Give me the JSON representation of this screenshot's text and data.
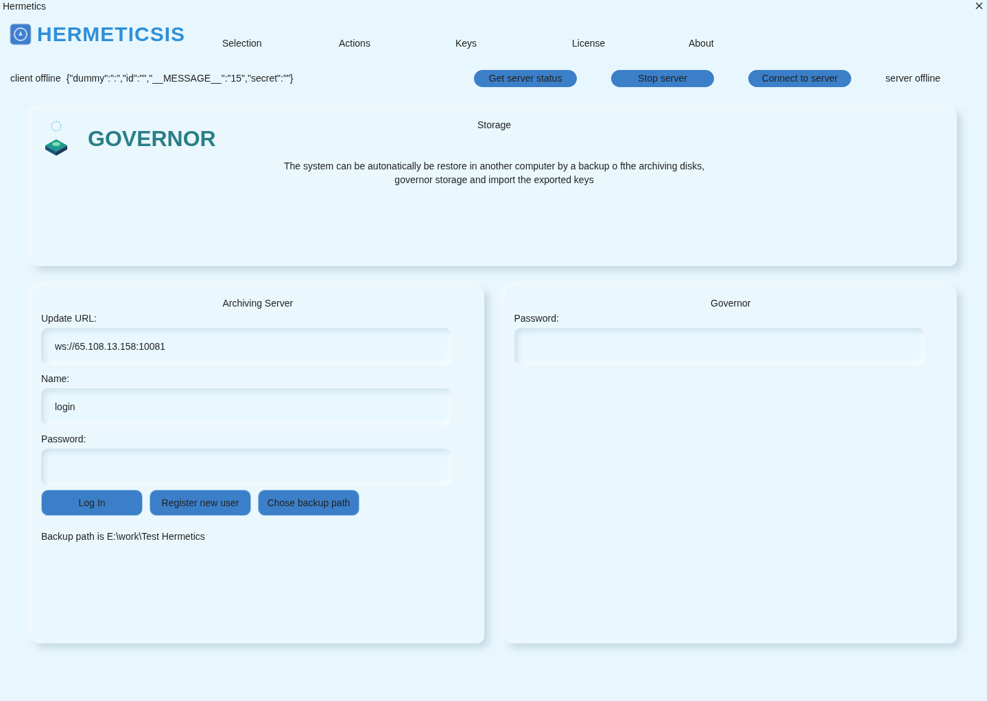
{
  "window": {
    "title": "Hermetics"
  },
  "brand": {
    "name": "HERMETICSIS"
  },
  "menu": [
    {
      "label": "Selection"
    },
    {
      "label": "Actions"
    },
    {
      "label": "Keys"
    },
    {
      "label": "License"
    },
    {
      "label": "About"
    }
  ],
  "status": {
    "client": "client offline",
    "message": "{\"dummy\":\":\",\"id\":\"\",\"__MESSAGE__\":\"15\",\"secret\":\"\"}",
    "server": "server offline"
  },
  "server_buttons": [
    "Get server status",
    "Stop server",
    "Connect to server"
  ],
  "storage": {
    "logo": "GOVERNOR",
    "title": "Storage",
    "description": "The system can be autonatically be restore in another computer by a backup o fthe archiving disks,\ngovernor storage and import the exported keys"
  },
  "archiving": {
    "title": "Archiving Server",
    "fields": [
      {
        "label": "Update URL:",
        "value": "ws://65.108.13.158:10081"
      },
      {
        "label": "Name:",
        "value": "login"
      },
      {
        "label": "Password:"
      }
    ],
    "buttons": [
      "Log In",
      "Register new user",
      "Chose backup path"
    ],
    "backup_path": "Backup path is E:\\work\\Test Hermetics"
  },
  "governor": {
    "title": "Governor",
    "fields": [
      {
        "label": "Password:"
      }
    ]
  }
}
